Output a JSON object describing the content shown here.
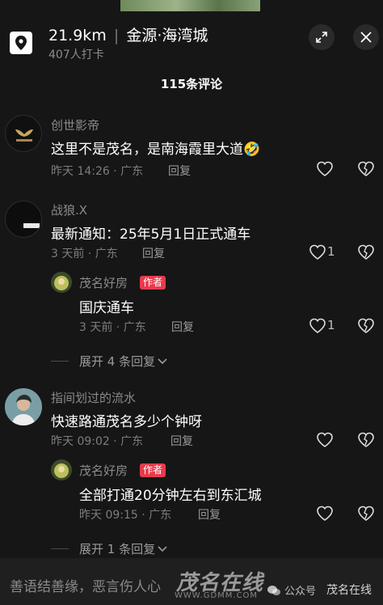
{
  "location": {
    "distance": "21.9km",
    "separator": "|",
    "place": "金源·海湾城",
    "checkins": "407人打卡"
  },
  "header": {
    "comment_count": "115条评论"
  },
  "comments": [
    {
      "user": "创世影帝",
      "text": "这里不是茂名，是南海霞里大道🤣",
      "meta": "昨天 14:26 · 广东",
      "reply": "回复",
      "likes": ""
    },
    {
      "user": "战狼.X",
      "text": "最新通知：25年5月1日正式通车",
      "meta": "3 天前 · 广东",
      "reply": "回复",
      "likes": "1",
      "sub_reply": {
        "user": "茂名好房",
        "badge": "作者",
        "text": "国庆通车",
        "meta": "3 天前 · 广东",
        "reply": "回复",
        "likes": "1"
      },
      "expand": "展开 4 条回复"
    },
    {
      "user": "指间划过的流水",
      "text": "快速路通茂名多少个钟呀",
      "meta": "昨天 09:02 · 广东",
      "reply": "回复",
      "likes": "",
      "sub_reply": {
        "user": "茂名好房",
        "badge": "作者",
        "text": "全部打通20分钟左右到东汇城",
        "meta": "昨天 09:15 · 广东",
        "reply": "回复",
        "likes": ""
      },
      "expand": "展开 1 条回复"
    }
  ],
  "input": {
    "placeholder": "善语结善缘，恶言伤人心"
  },
  "watermark": {
    "logo": "茂名在线",
    "url": "WWW.GDMM.COM",
    "public": "公众号",
    "name": "茂名在线"
  },
  "colors": {
    "background": "#161616",
    "author_badge": "#e83a4d",
    "secondary_text": "#8a8a8a"
  }
}
